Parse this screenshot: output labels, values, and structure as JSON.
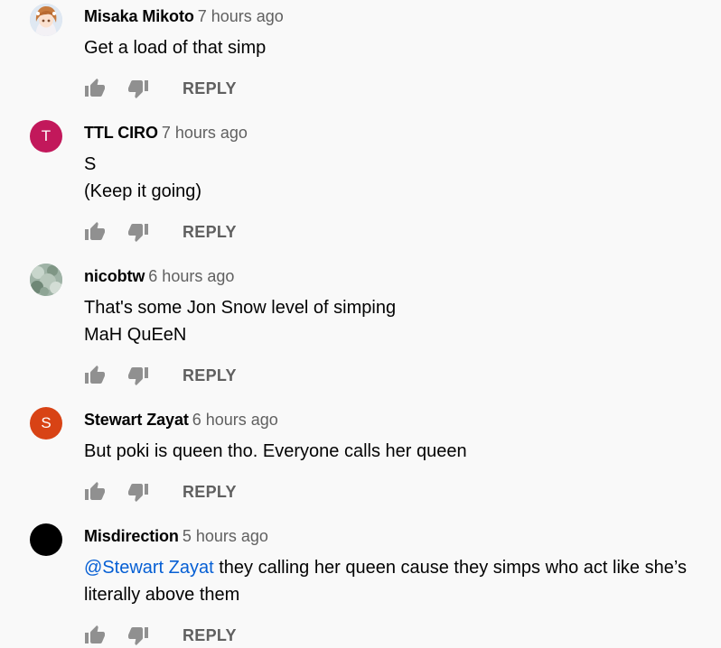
{
  "reply_label": "REPLY",
  "comments": [
    {
      "author": "Misaka Mikoto",
      "time": "7 hours ago",
      "avatar_letter": "",
      "avatar_color": "#c9d6e6",
      "lines": [
        "Get a load of that simp"
      ]
    },
    {
      "author": "TTL CIRO",
      "time": "7 hours ago",
      "avatar_letter": "T",
      "avatar_color": "#c2185b",
      "lines": [
        "S",
        "(Keep it going)"
      ]
    },
    {
      "author": "nicobtw",
      "time": "6 hours ago",
      "avatar_letter": "",
      "avatar_color": "#8aa294",
      "lines": [
        "That's some Jon Snow level of simping",
        "MaH QuEeN"
      ]
    },
    {
      "author": "Stewart Zayat",
      "time": "6 hours ago",
      "avatar_letter": "S",
      "avatar_color": "#d84315",
      "lines": [
        "But poki is queen tho. Everyone calls her queen"
      ]
    },
    {
      "author": "Misdirection",
      "time": "5 hours ago",
      "avatar_letter": "",
      "avatar_color": "#000000",
      "mention": "@Stewart Zayat",
      "mention_color": "#065fd4",
      "lines": [
        " they calling her queen cause they simps who act like she’s",
        "literally above them"
      ]
    }
  ]
}
